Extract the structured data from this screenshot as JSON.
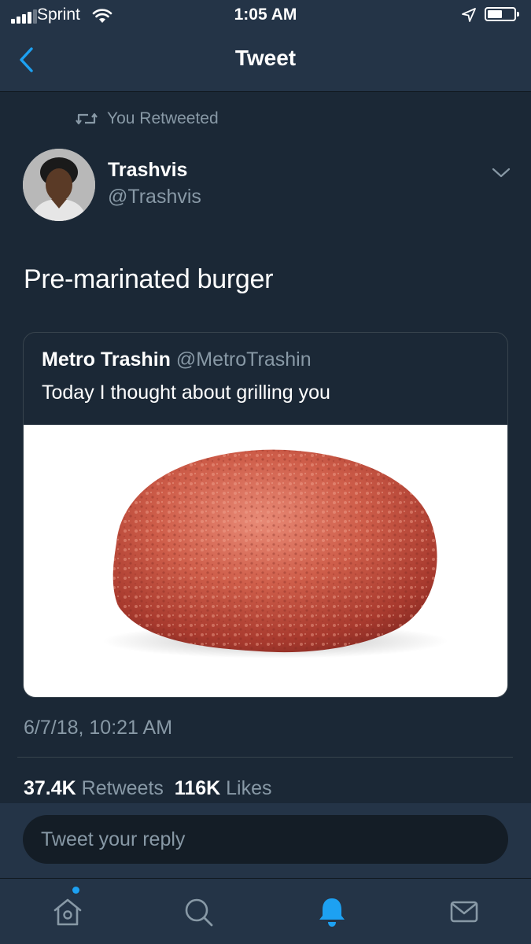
{
  "status_bar": {
    "carrier": "Sprint",
    "time": "1:05 AM",
    "signal_bars_filled": 4,
    "battery_level": 0.5
  },
  "nav": {
    "title": "Tweet",
    "back_icon": "chevron-left-icon"
  },
  "retweet_context": {
    "text": "You Retweeted",
    "icon": "retweet-icon"
  },
  "author": {
    "name": "Trashvis",
    "handle": "@Trashvis"
  },
  "tweet": {
    "text": "Pre-marinated burger",
    "timestamp": "6/7/18, 10:21 AM"
  },
  "quoted_tweet": {
    "name": "Metro Trashin",
    "handle": "@MetroTrashin",
    "text": "Today I thought about grilling you"
  },
  "stats": {
    "retweets_count": "37.4K",
    "retweets_label": "Retweets",
    "likes_count": "116K",
    "likes_label": "Likes"
  },
  "reply": {
    "placeholder": "Tweet your reply"
  },
  "tabs": [
    {
      "name": "home",
      "icon": "home-icon",
      "active": false,
      "has_dot": true
    },
    {
      "name": "search",
      "icon": "search-icon",
      "active": false
    },
    {
      "name": "notifications",
      "icon": "bell-icon",
      "active": true
    },
    {
      "name": "messages",
      "icon": "envelope-icon",
      "active": false
    }
  ],
  "colors": {
    "background": "#1b2836",
    "bar": "#243447",
    "accent": "#1da1f2",
    "secondary_text": "#8899a6",
    "border": "#38444d"
  }
}
